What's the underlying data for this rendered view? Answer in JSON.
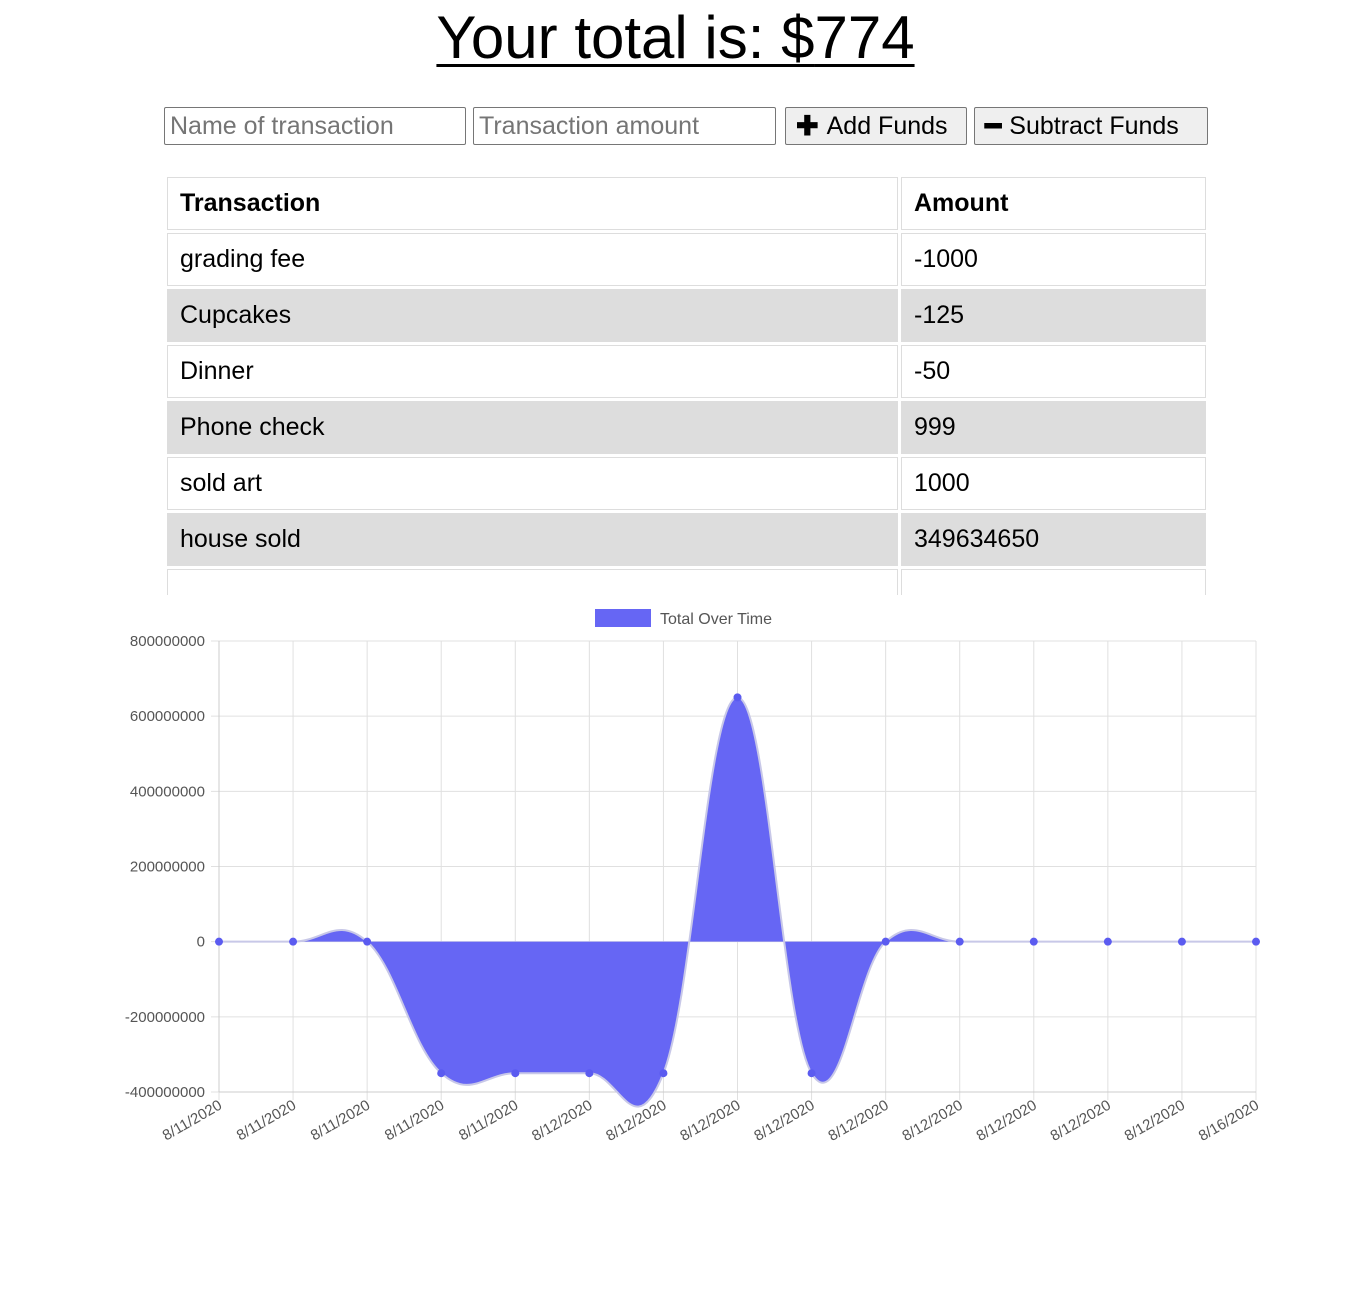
{
  "header": {
    "total_label": "Your total is: $",
    "total_value": "774"
  },
  "form": {
    "name_placeholder": "Name of transaction",
    "amount_placeholder": "Transaction amount",
    "add_icon": "plus-icon",
    "add_label": "Add Funds",
    "subtract_icon": "minus-icon",
    "subtract_label": "Subtract Funds"
  },
  "table": {
    "headers": [
      "Transaction",
      "Amount"
    ],
    "rows": [
      {
        "name": "grading fee",
        "amount": "-1000"
      },
      {
        "name": "Cupcakes",
        "amount": "-125"
      },
      {
        "name": "Dinner",
        "amount": "-50"
      },
      {
        "name": "Phone check",
        "amount": "999"
      },
      {
        "name": "sold art",
        "amount": "1000"
      },
      {
        "name": "house sold",
        "amount": "349634650"
      }
    ]
  },
  "colors": {
    "series_fill": "#6666f4",
    "series_point": "#5b5bf0",
    "grid": "#e0e0e0"
  },
  "chart_data": {
    "type": "area",
    "legend": "Total Over Time",
    "legend_position": "top",
    "grid": true,
    "ylim": [
      -400000000,
      800000000
    ],
    "yticks": [
      800000000,
      600000000,
      400000000,
      200000000,
      0,
      -200000000,
      -400000000
    ],
    "x": [
      "8/11/2020",
      "8/11/2020",
      "8/11/2020",
      "8/11/2020",
      "8/11/2020",
      "8/12/2020",
      "8/12/2020",
      "8/12/2020",
      "8/12/2020",
      "8/12/2020",
      "8/12/2020",
      "8/12/2020",
      "8/12/2020",
      "8/12/2020",
      "8/16/2020"
    ],
    "series": [
      {
        "name": "Total Over Time",
        "values": [
          0,
          0,
          0,
          -350000000,
          -350000000,
          -350000000,
          -350000000,
          650000000,
          -350000000,
          0,
          0,
          0,
          0,
          0,
          0
        ]
      }
    ]
  }
}
